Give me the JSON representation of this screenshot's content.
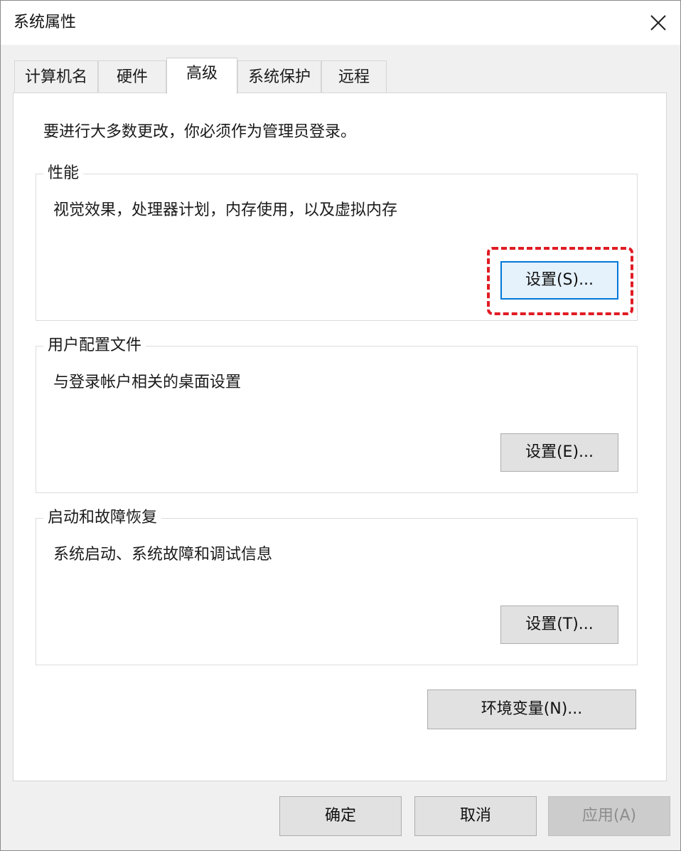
{
  "window": {
    "title": "系统属性",
    "close_icon": "close-icon"
  },
  "tabs": [
    {
      "label": "计算机名",
      "active": false
    },
    {
      "label": "硬件",
      "active": false
    },
    {
      "label": "高级",
      "active": true
    },
    {
      "label": "系统保护",
      "active": false
    },
    {
      "label": "远程",
      "active": false
    }
  ],
  "advanced": {
    "notice": "要进行大多数更改，你必须作为管理员登录。",
    "performance": {
      "title": "性能",
      "description": "视觉效果，处理器计划，内存使用，以及虚拟内存",
      "button_label": "设置(S)..."
    },
    "user_profiles": {
      "title": "用户配置文件",
      "description": "与登录帐户相关的桌面设置",
      "button_label": "设置(E)..."
    },
    "startup_recovery": {
      "title": "启动和故障恢复",
      "description": "系统启动、系统故障和调试信息",
      "button_label": "设置(T)..."
    },
    "env_button_label": "环境变量(N)..."
  },
  "footer": {
    "ok_label": "确定",
    "cancel_label": "取消",
    "apply_label": "应用(A)"
  },
  "colors": {
    "highlight": "#e01b24",
    "focus": "#0078d7"
  }
}
